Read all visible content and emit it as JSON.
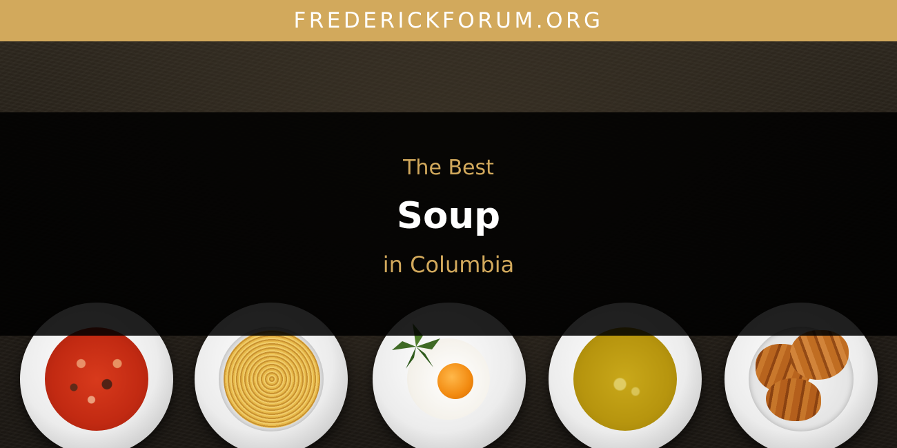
{
  "site": {
    "name": "FREDERICKFORUM.ORG"
  },
  "headline": {
    "line_top": "The Best",
    "line_main": "Soup",
    "line_bottom": "in Columbia"
  },
  "colors": {
    "accent": "#d2a95c",
    "band": "#000000",
    "main_text": "#ffffff"
  },
  "plates": [
    {
      "dish": "minestrone-soup"
    },
    {
      "dish": "spaghetti"
    },
    {
      "dish": "fried-egg"
    },
    {
      "dish": "cream-soup"
    },
    {
      "dish": "croissants"
    }
  ]
}
